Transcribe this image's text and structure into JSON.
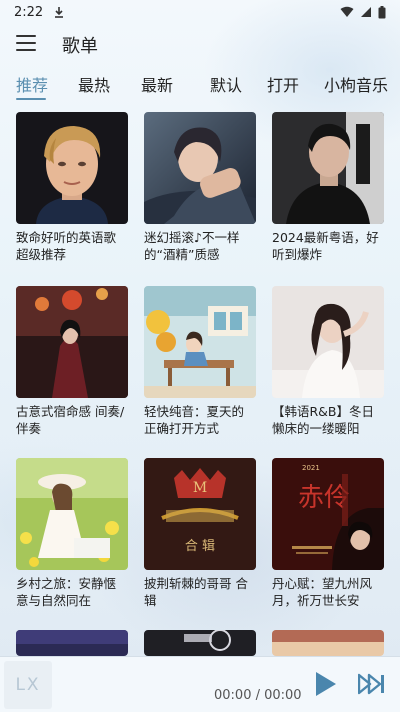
{
  "status_bar": {
    "time": "2:22"
  },
  "header": {
    "title": "歌单"
  },
  "tabs": [
    {
      "label": "推荐",
      "active": true
    },
    {
      "label": "最热"
    },
    {
      "label": "最新"
    },
    {
      "label": "默认"
    },
    {
      "label": "打开"
    },
    {
      "label": "小枸音乐"
    }
  ],
  "playlists": [
    {
      "title": "致命好听的英语歌 超级推荐"
    },
    {
      "title": "迷幻摇滚♪不一样的“酒精”质感"
    },
    {
      "title": "2024最新粤语，好听到爆炸"
    },
    {
      "title": "古意式宿命感 间奏/伴奏"
    },
    {
      "title": "轻快纯音：夏天的正确打开方式"
    },
    {
      "title": "【韩语R&B】冬日懒床的一缕暖阳"
    },
    {
      "title": "乡村之旅：安静惬意与自然同在"
    },
    {
      "title": "披荆斩棘的哥哥 合辑"
    },
    {
      "title": "丹心赋：望九州风月，祈万世长安"
    },
    {
      "title": ""
    },
    {
      "title": ""
    },
    {
      "title": ""
    }
  ],
  "covers": {
    "cover_7_text": "合 辑",
    "cover_8_year": "2021",
    "cover_8_main": "赤伶"
  },
  "player": {
    "logo": "LX",
    "time": "00:00 / 00:00"
  },
  "colors": {
    "accent": "#5b8fb0",
    "play": "#4a86ad"
  }
}
